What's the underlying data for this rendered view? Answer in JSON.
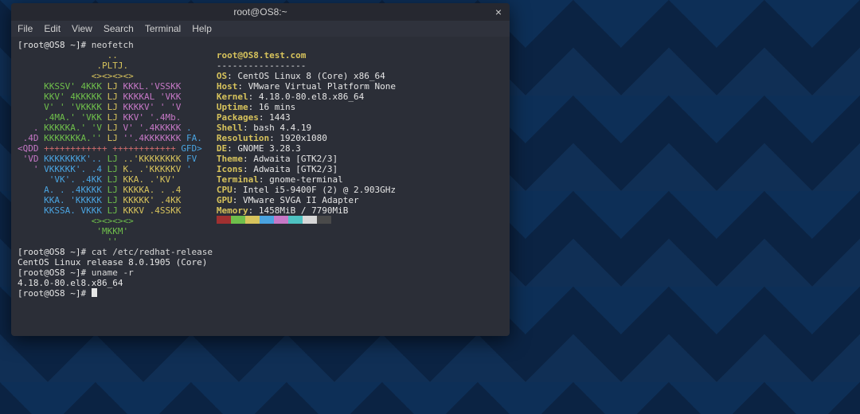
{
  "window": {
    "title": "root@OS8:~"
  },
  "menubar": [
    "File",
    "Edit",
    "View",
    "Search",
    "Terminal",
    "Help"
  ],
  "prompt1": {
    "text": "[root@OS8 ~]# ",
    "cmd": "neofetch"
  },
  "logo_lines": [
    [
      {
        "c": "c-y",
        "t": "                 .."
      }
    ],
    [
      {
        "c": "c-y",
        "t": "               .PLTJ."
      }
    ],
    [
      {
        "c": "c-y",
        "t": "              <><><><>"
      }
    ],
    [
      {
        "c": "c-g",
        "t": "     KKSSV' 4KKK "
      },
      {
        "c": "c-y",
        "t": "LJ "
      },
      {
        "c": "c-m",
        "t": "KKKL.'VSSKK"
      }
    ],
    [
      {
        "c": "c-g",
        "t": "     KKV' 4KKKKK "
      },
      {
        "c": "c-y",
        "t": "LJ "
      },
      {
        "c": "c-m",
        "t": "KKKKAL 'VKK"
      }
    ],
    [
      {
        "c": "c-g",
        "t": "     V' ' 'VKKKK "
      },
      {
        "c": "c-y",
        "t": "LJ "
      },
      {
        "c": "c-m",
        "t": "KKKKV' ' 'V"
      }
    ],
    [
      {
        "c": "c-g",
        "t": "     .4MA.' 'VKK "
      },
      {
        "c": "c-y",
        "t": "LJ "
      },
      {
        "c": "c-m",
        "t": "KKV' '.4Mb."
      }
    ],
    [
      {
        "c": "c-m",
        "t": "   . "
      },
      {
        "c": "c-g",
        "t": "KKKKKA.' 'V "
      },
      {
        "c": "c-y",
        "t": "LJ "
      },
      {
        "c": "c-m",
        "t": "V' '.4KKKKK "
      },
      {
        "c": "c-b",
        "t": "."
      }
    ],
    [
      {
        "c": "c-m",
        "t": " .4D "
      },
      {
        "c": "c-g",
        "t": "KKKKKKKA.'' "
      },
      {
        "c": "c-y",
        "t": "LJ "
      },
      {
        "c": "c-m",
        "t": "''.4KKKKKKK "
      },
      {
        "c": "c-b",
        "t": "FA."
      }
    ],
    [
      {
        "c": "c-m",
        "t": "<QDD "
      },
      {
        "c": "c-r",
        "t": "++++++++++++ ++++++++++++ "
      },
      {
        "c": "c-b",
        "t": "GFD>"
      }
    ],
    [
      {
        "c": "c-m",
        "t": " 'VD "
      },
      {
        "c": "c-b",
        "t": "KKKKKKKK'.. "
      },
      {
        "c": "c-g",
        "t": "LJ "
      },
      {
        "c": "c-y",
        "t": "..'KKKKKKKK "
      },
      {
        "c": "c-b",
        "t": "FV"
      }
    ],
    [
      {
        "c": "c-m",
        "t": "   ' "
      },
      {
        "c": "c-b",
        "t": "VKKKKK'. .4 "
      },
      {
        "c": "c-g",
        "t": "LJ "
      },
      {
        "c": "c-y",
        "t": "K. .'KKKKKV "
      },
      {
        "c": "c-b",
        "t": "'"
      }
    ],
    [
      {
        "c": "c-b",
        "t": "      'VK'. .4KK "
      },
      {
        "c": "c-g",
        "t": "LJ "
      },
      {
        "c": "c-y",
        "t": "KKA. .'KV'"
      }
    ],
    [
      {
        "c": "c-b",
        "t": "     A. . .4KKKK "
      },
      {
        "c": "c-g",
        "t": "LJ "
      },
      {
        "c": "c-y",
        "t": "KKKKA. . .4"
      }
    ],
    [
      {
        "c": "c-b",
        "t": "     KKA. 'KKKKK "
      },
      {
        "c": "c-g",
        "t": "LJ "
      },
      {
        "c": "c-y",
        "t": "KKKKK' .4KK"
      }
    ],
    [
      {
        "c": "c-b",
        "t": "     KKSSA. VKKK "
      },
      {
        "c": "c-g",
        "t": "LJ "
      },
      {
        "c": "c-y",
        "t": "KKKV .4SSKK"
      }
    ],
    [
      {
        "c": "c-g",
        "t": "              <><><><>"
      }
    ],
    [
      {
        "c": "c-g",
        "t": "               'MKKM'"
      }
    ],
    [
      {
        "c": "c-g",
        "t": "                 ''"
      }
    ]
  ],
  "info_header": "root@OS8.test.com",
  "info_sep": "-----------------",
  "info": [
    {
      "k": "OS",
      "v": "CentOS Linux 8 (Core) x86_64"
    },
    {
      "k": "Host",
      "v": "VMware Virtual Platform None"
    },
    {
      "k": "Kernel",
      "v": "4.18.0-80.el8.x86_64"
    },
    {
      "k": "Uptime",
      "v": "16 mins"
    },
    {
      "k": "Packages",
      "v": "1443"
    },
    {
      "k": "Shell",
      "v": "bash 4.4.19"
    },
    {
      "k": "Resolution",
      "v": "1920x1080"
    },
    {
      "k": "DE",
      "v": "GNOME 3.28.3"
    },
    {
      "k": "Theme",
      "v": "Adwaita [GTK2/3]"
    },
    {
      "k": "Icons",
      "v": "Adwaita [GTK2/3]"
    },
    {
      "k": "Terminal",
      "v": "gnome-terminal"
    },
    {
      "k": "CPU",
      "v": "Intel i5-9400F (2) @ 2.903GHz"
    },
    {
      "k": "GPU",
      "v": "VMware SVGA II Adapter"
    },
    {
      "k": "Memory",
      "v": "1458MiB / 7790MiB"
    }
  ],
  "swatches": [
    "#a03030",
    "#6fbf4b",
    "#d7c35c",
    "#4aa3df",
    "#c678c6",
    "#4ec2c2",
    "#d7d7d7",
    "#4a4a4a"
  ],
  "tail": [
    {
      "type": "prompt",
      "text": "[root@OS8 ~]# ",
      "cmd": "cat /etc/redhat-release"
    },
    {
      "type": "out",
      "text": "CentOS Linux release 8.0.1905 (Core)"
    },
    {
      "type": "prompt",
      "text": "[root@OS8 ~]# ",
      "cmd": "uname -r"
    },
    {
      "type": "out",
      "text": "4.18.0-80.el8.x86_64"
    },
    {
      "type": "prompt",
      "text": "[root@OS8 ~]# ",
      "cmd": ""
    }
  ]
}
